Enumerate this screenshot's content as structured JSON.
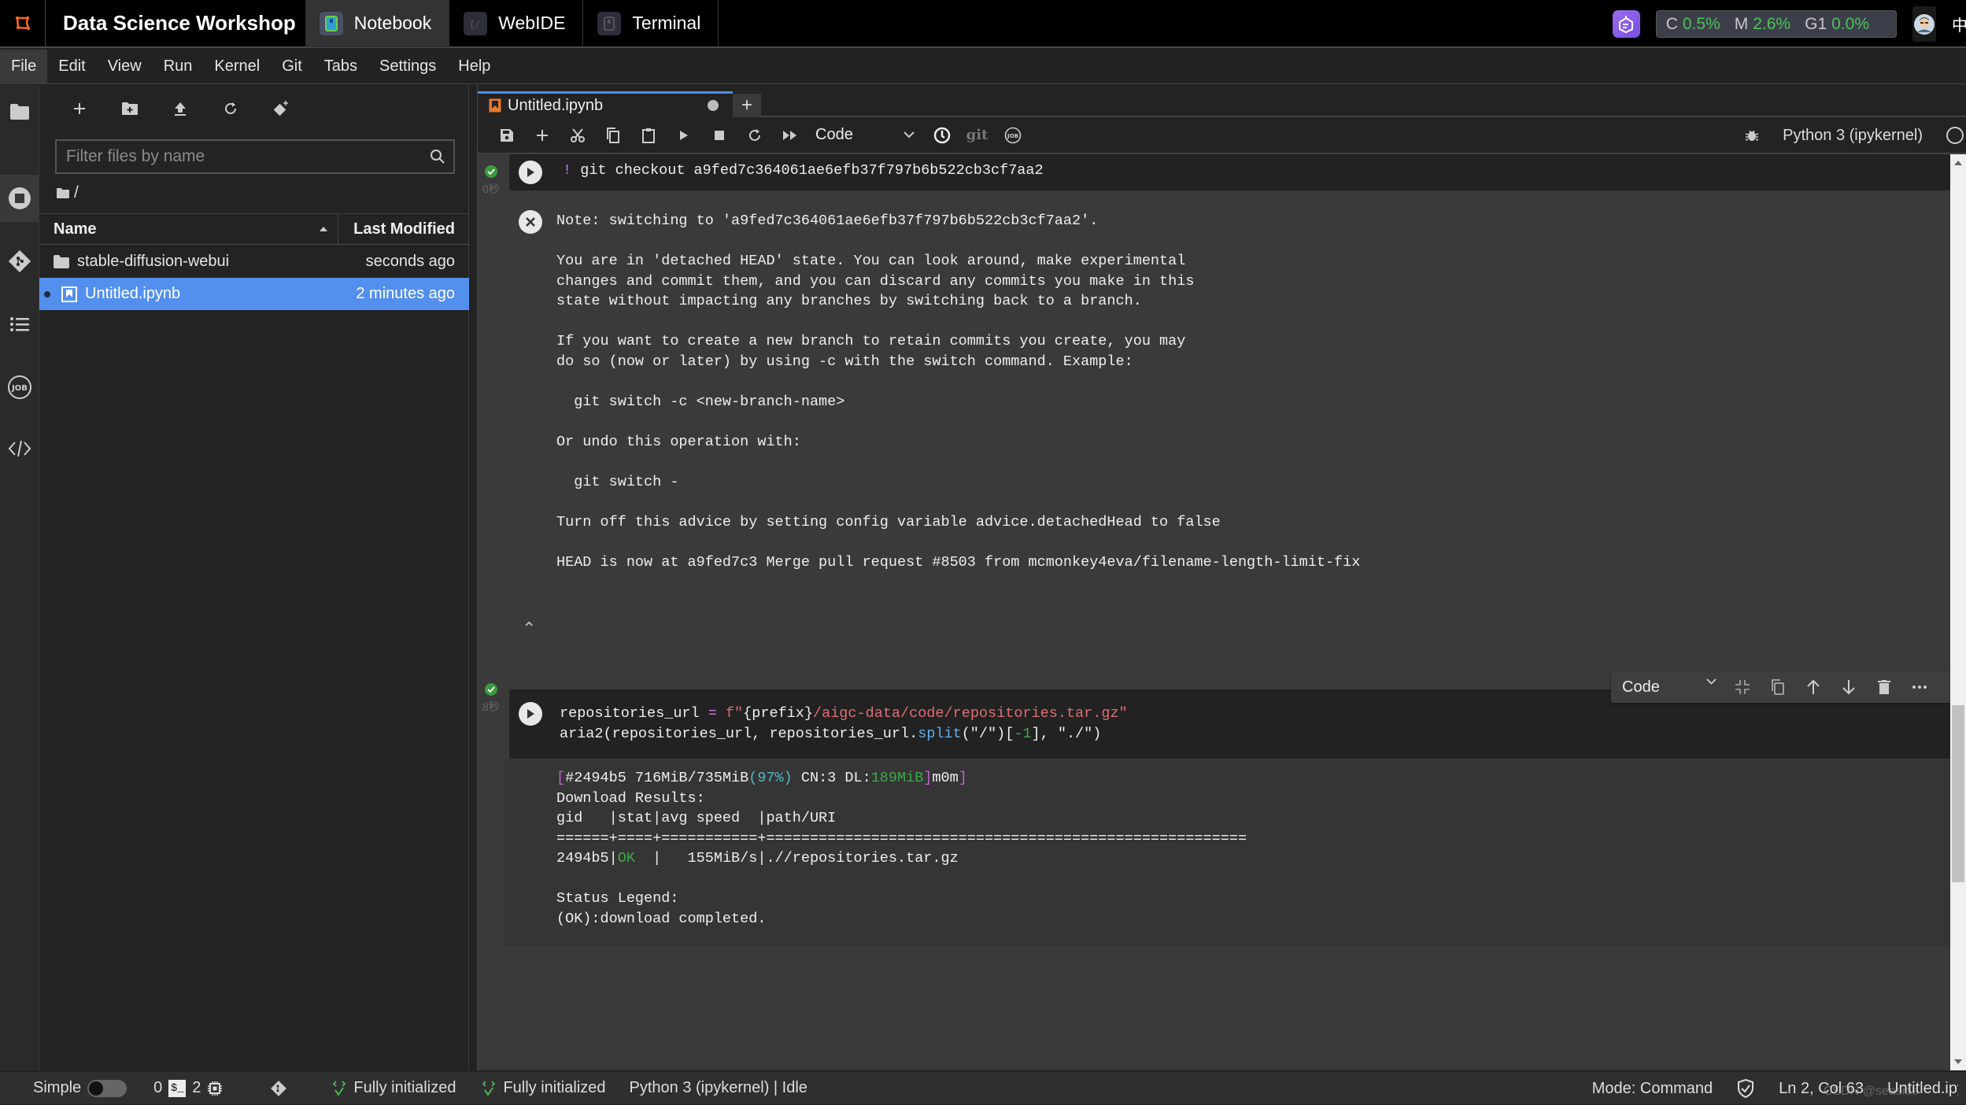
{
  "topbar": {
    "app_title": "Data Science Workshop",
    "tabs": [
      {
        "label": "Notebook",
        "icon": "notebook-icon",
        "active": true
      },
      {
        "label": "WebIDE",
        "icon": "code-brackets-icon",
        "active": false
      },
      {
        "label": "Terminal",
        "icon": "terminal-icon",
        "active": false
      }
    ],
    "resources": {
      "c_label": "C",
      "c_value": "0.5%",
      "m_label": "M",
      "m_value": "2.6%",
      "g_label": "G1",
      "g_value": "0.0%"
    },
    "lang": "中"
  },
  "menu": [
    "File",
    "Edit",
    "View",
    "Run",
    "Kernel",
    "Git",
    "Tabs",
    "Settings",
    "Help"
  ],
  "file_browser": {
    "filter_placeholder": "Filter files by name",
    "breadcrumb": "/",
    "columns": {
      "name": "Name",
      "modified": "Last Modified"
    },
    "files": [
      {
        "name": "stable-diffusion-webui",
        "modified": "seconds ago",
        "type": "folder",
        "selected": false
      },
      {
        "name": "Untitled.ipynb",
        "modified": "2 minutes ago",
        "type": "notebook",
        "selected": true
      }
    ]
  },
  "notebook": {
    "tab_label": "Untitled.ipynb",
    "cell_type": "Code",
    "git_label": "git",
    "kernel": "Python 3 (ipykernel)",
    "cells": [
      {
        "time": "0秒",
        "input_bang": "!",
        "input": " git checkout a9fed7c364061ae6efb37f797b6b522cb3cf7aa2",
        "output_lines": [
          "Note: switching to 'a9fed7c364061ae6efb37f797b6b522cb3cf7aa2'.",
          "",
          "You are in 'detached HEAD' state. You can look around, make experimental",
          "changes and commit them, and you can discard any commits you make in this",
          "state without impacting any branches by switching back to a branch.",
          "",
          "If you want to create a new branch to retain commits you create, you may",
          "do so (now or later) by using -c with the switch command. Example:",
          "",
          "  git switch -c <new-branch-name>",
          "",
          "Or undo this operation with:",
          "",
          "  git switch -",
          "",
          "Turn off this advice by setting config variable advice.detachedHead to false",
          "",
          "HEAD is now at a9fed7c3 Merge pull request #8503 from mcmonkey4eva/filename-length-limit-fix"
        ]
      },
      {
        "time": "8秒",
        "code": {
          "l1_var": "repositories_url ",
          "l1_op": "=",
          "l1_f": " f\"",
          "l1_brace": "{prefix}",
          "l1_str": "/aigc-data/code/repositories.tar.gz\"",
          "l2_a": "aria2(repositories_url, repositories_url.",
          "l2_split": "split",
          "l2_b": "(\"/\")[",
          "l2_neg": "-1",
          "l2_c": "], \"./\")"
        },
        "progress": {
          "open": "[",
          "a": "#2494b5 716MiB/735MiB",
          "pct": "(97%)",
          "b": " CN:3 DL:",
          "dl": "189MiB",
          "close1": "]",
          "c": "m0m",
          "close2": "]"
        },
        "results_title": "Download Results:",
        "results_header": "gid   |stat|avg speed  |path/URI",
        "results_sep": "======+====+===========+=======================================================",
        "row_gid": "2494b5|",
        "row_stat": "OK",
        "row_rest": "  |   155MiB/s|.//repositories.tar.gz",
        "legend_title": "Status Legend:",
        "legend_line": "(OK):download completed."
      }
    ],
    "cell_toolbar_type": "Code"
  },
  "statusbar": {
    "mode_label": "Simple",
    "terminals": "0",
    "kernels": "2",
    "lsp1": "Fully initialized",
    "lsp2": "Fully initialized",
    "kernel_status": "Python 3 (ipykernel) | Idle",
    "mode": "Mode: Command",
    "position": "Ln 2, Col 63",
    "file": "Untitled.ipynb"
  },
  "watermark": "CSDN @seaside"
}
